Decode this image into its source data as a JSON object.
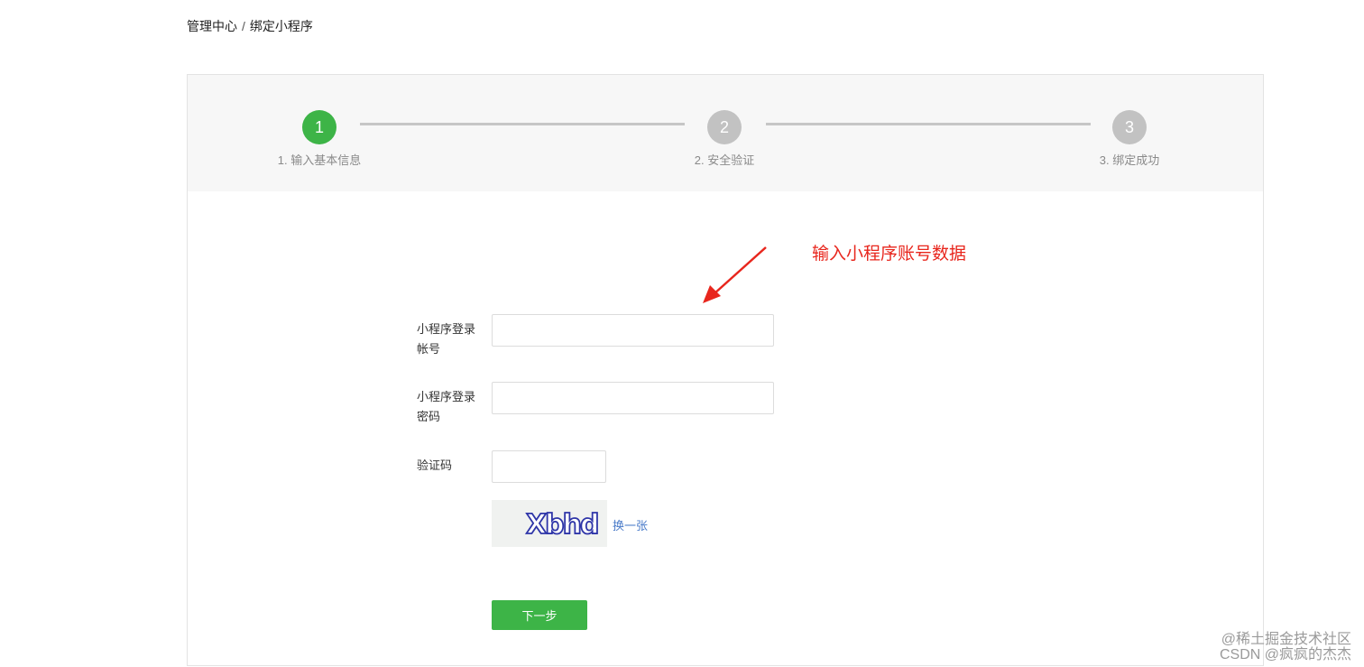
{
  "breadcrumb": {
    "parent": "管理中心",
    "separator": "/",
    "current": "绑定小程序"
  },
  "steps": [
    {
      "number": "1",
      "label": "1. 输入基本信息",
      "state": "active"
    },
    {
      "number": "2",
      "label": "2. 安全验证",
      "state": "inactive"
    },
    {
      "number": "3",
      "label": "3. 绑定成功",
      "state": "inactive"
    }
  ],
  "annotation": {
    "text": "输入小程序账号数据",
    "color": "#e8261d"
  },
  "form": {
    "account_label": "小程序登录帐号",
    "account_value": "",
    "password_label": "小程序登录密码",
    "password_value": "",
    "captcha_label": "验证码",
    "captcha_value": "",
    "captcha_image_text": "Xbhd",
    "refresh_captcha": "换一张",
    "next_button": "下一步"
  },
  "watermark": {
    "line1": "@稀土掘金技术社区",
    "line2": "CSDN @疯疯的杰杰"
  },
  "colors": {
    "primary_green": "#3db447",
    "inactive_gray": "#c2c2c2",
    "link_blue": "#4a7bc9",
    "annotation_red": "#e8261d"
  }
}
